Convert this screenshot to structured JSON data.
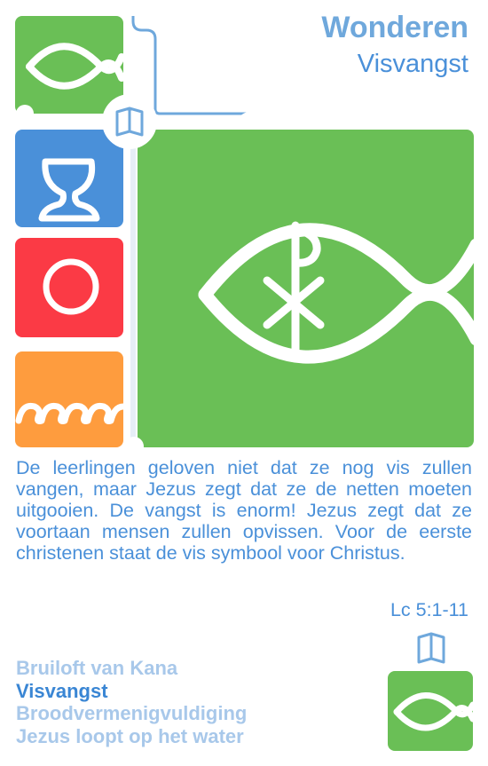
{
  "header": {
    "category": "Wonderen",
    "card_title": "Visvangst"
  },
  "description": "De leerlingen geloven niet dat ze nog vis zullen vangen, maar Jezus zegt dat ze de netten moeten uitgooien. De vangst is enorm! Jezus zegt dat ze voortaan mensen zullen opvissen. Voor de eerste christenen staat de vis symbool voor Christus.",
  "reference": "Lc 5:1-11",
  "card_set": [
    {
      "label": "Bruiloft van Kana",
      "current": false
    },
    {
      "label": "Visvangst",
      "current": true
    },
    {
      "label": "Broodvermenigvuldiging",
      "current": false
    },
    {
      "label": "Jezus loopt op het water",
      "current": false
    }
  ],
  "colors": {
    "green": "#6abf56",
    "blue": "#4a90d9",
    "red": "#fb3a45",
    "orange": "#fe9c3e",
    "light_blue_text": "#a8c8ea",
    "accent_text": "#4a90d9"
  },
  "icons": {
    "top_left_tile": "fish-icon",
    "main_tile": "fish-chi-rho-icon",
    "blue_tile": "hourglass-icon",
    "red_tile": "circle-icon",
    "orange_tile": "waves-icon",
    "book": "book-icon",
    "bottom_tile": "fish-icon"
  }
}
